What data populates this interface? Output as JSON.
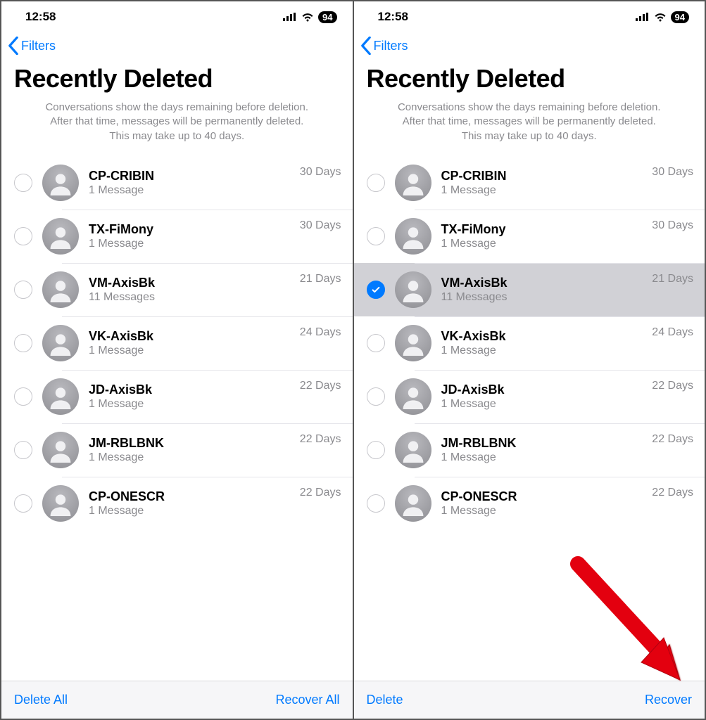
{
  "status": {
    "time": "12:58",
    "battery": "94"
  },
  "nav": {
    "back": "Filters"
  },
  "title": "Recently Deleted",
  "explain": {
    "l1": "Conversations show the days remaining before deletion.",
    "l2": "After that time, messages will be permanently deleted.",
    "l3": "This may take up to 40 days."
  },
  "left": {
    "items": [
      {
        "name": "CP-CRIBIN",
        "sub": "1 Message",
        "days": "30 Days"
      },
      {
        "name": "TX-FiMony",
        "sub": "1 Message",
        "days": "30 Days"
      },
      {
        "name": "VM-AxisBk",
        "sub": "11 Messages",
        "days": "21 Days"
      },
      {
        "name": "VK-AxisBk",
        "sub": "1 Message",
        "days": "24 Days"
      },
      {
        "name": "JD-AxisBk",
        "sub": "1 Message",
        "days": "22 Days"
      },
      {
        "name": "JM-RBLBNK",
        "sub": "1 Message",
        "days": "22 Days"
      },
      {
        "name": "CP-ONESCR",
        "sub": "1 Message",
        "days": "22 Days"
      }
    ],
    "toolbar": {
      "left": "Delete All",
      "right": "Recover All"
    }
  },
  "right": {
    "items": [
      {
        "name": "CP-CRIBIN",
        "sub": "1 Message",
        "days": "30 Days",
        "selected": false
      },
      {
        "name": "TX-FiMony",
        "sub": "1 Message",
        "days": "30 Days",
        "selected": false
      },
      {
        "name": "VM-AxisBk",
        "sub": "11 Messages",
        "days": "21 Days",
        "selected": true
      },
      {
        "name": "VK-AxisBk",
        "sub": "1 Message",
        "days": "24 Days",
        "selected": false
      },
      {
        "name": "JD-AxisBk",
        "sub": "1 Message",
        "days": "22 Days",
        "selected": false
      },
      {
        "name": "JM-RBLBNK",
        "sub": "1 Message",
        "days": "22 Days",
        "selected": false
      },
      {
        "name": "CP-ONESCR",
        "sub": "1 Message",
        "days": "22 Days",
        "selected": false
      }
    ],
    "toolbar": {
      "left": "Delete",
      "right": "Recover"
    }
  }
}
